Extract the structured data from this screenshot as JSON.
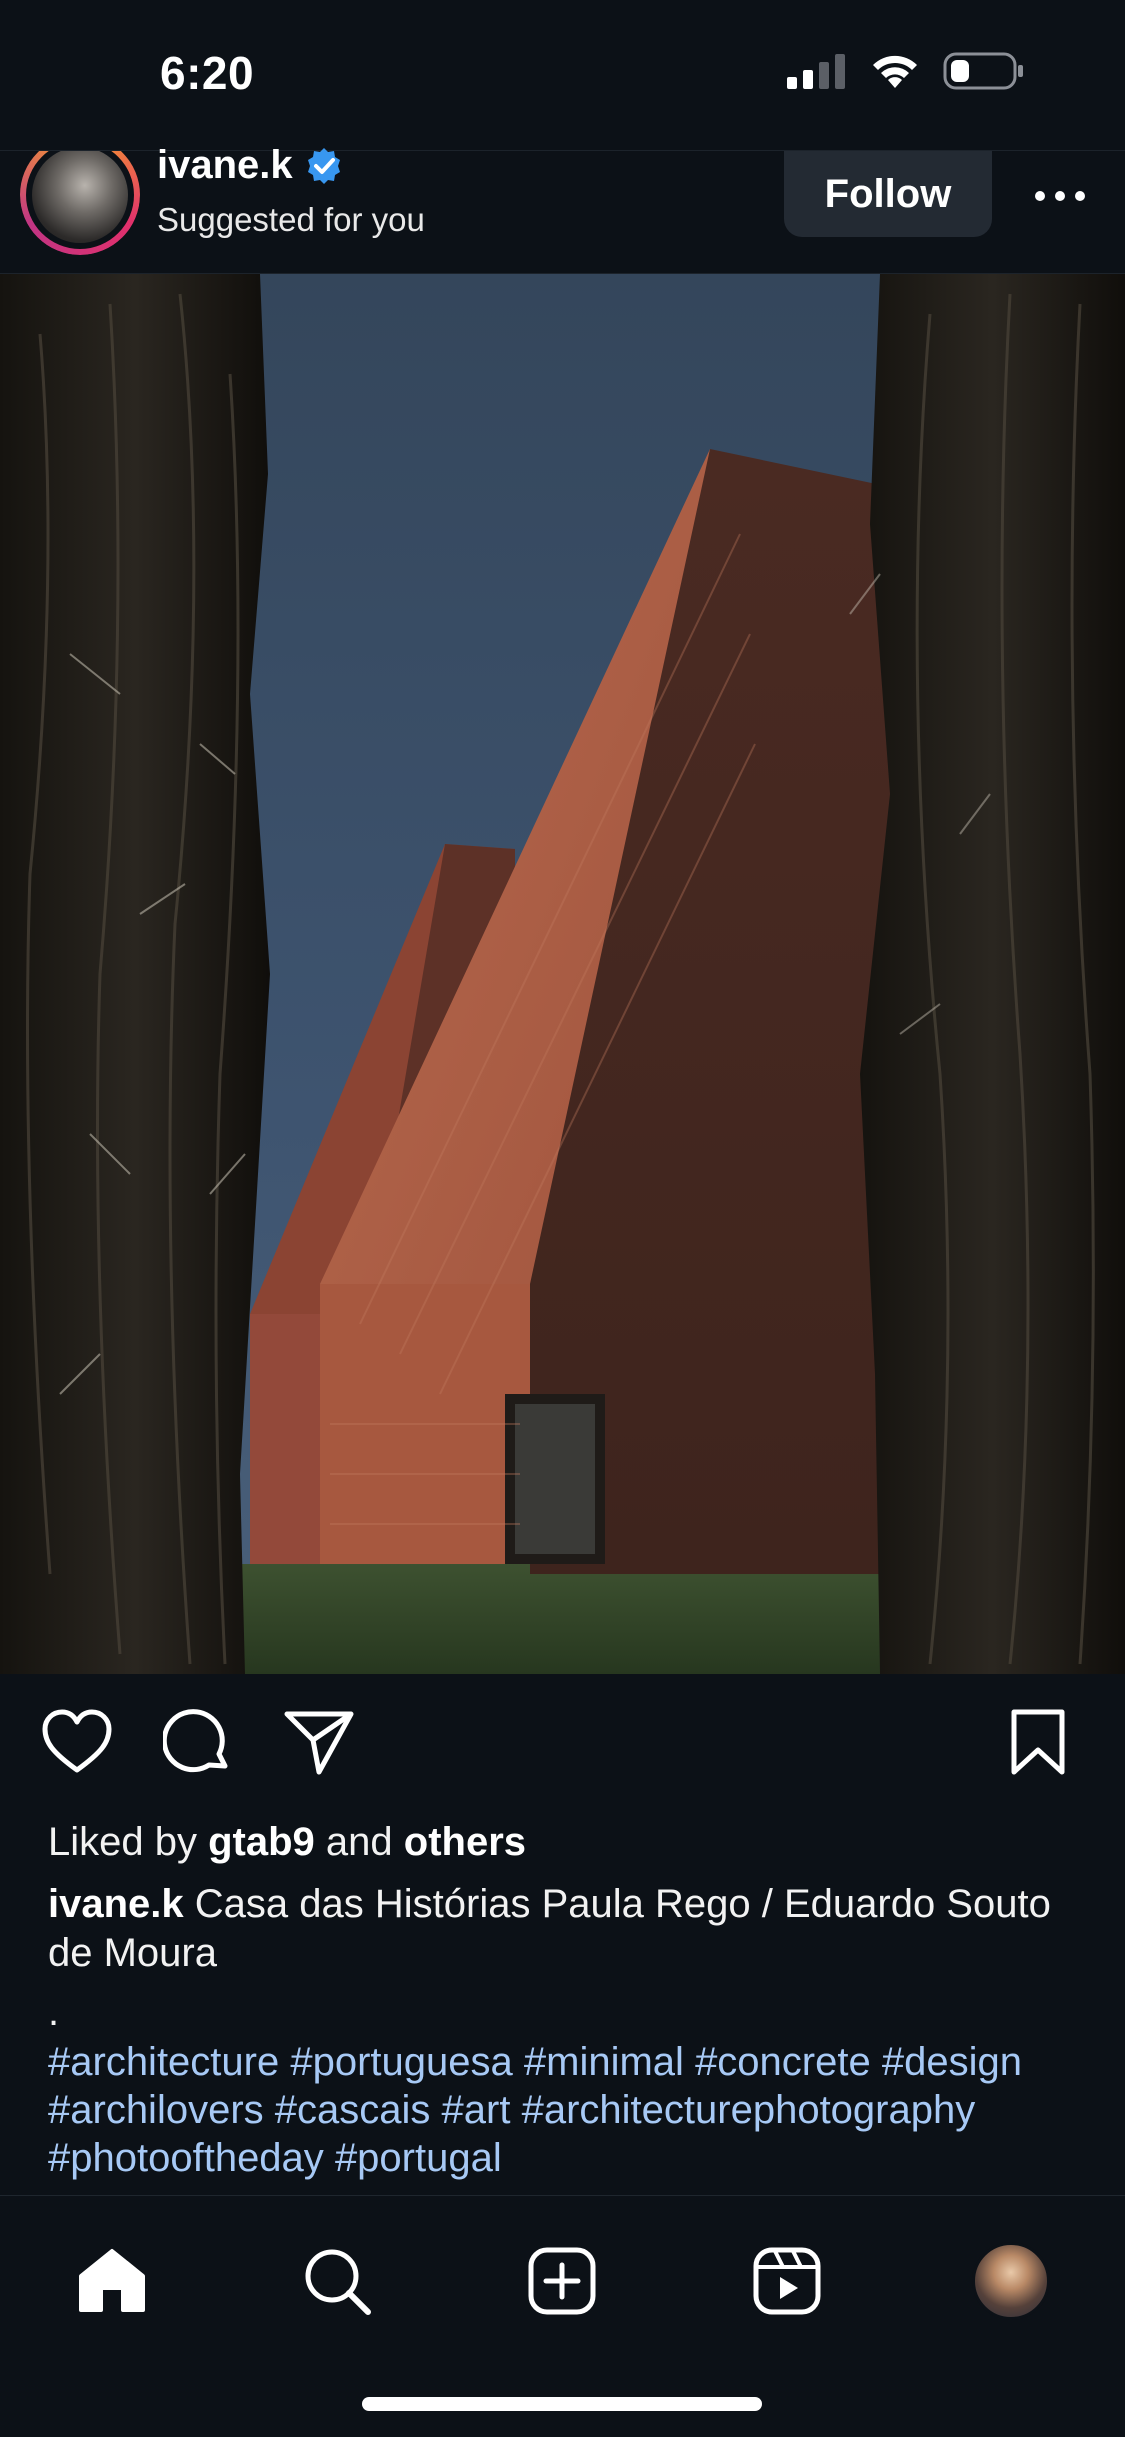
{
  "status_bar": {
    "time": "6:20",
    "signal_icon": "signal-icon",
    "wifi_icon": "wifi-icon",
    "battery_icon": "battery-icon"
  },
  "post": {
    "author": {
      "username": "ivane.k",
      "verified": true,
      "subtitle": "Suggested for you",
      "avatar_icon": "avatar"
    },
    "follow_label": "Follow",
    "more_icon": "more-options-icon",
    "image": {
      "subject": "post-photo"
    },
    "actions": {
      "like_icon": "heart-icon",
      "comment_icon": "comment-icon",
      "share_icon": "send-icon",
      "save_icon": "bookmark-icon"
    },
    "likes": {
      "prefix": "Liked by",
      "user": "gtab9",
      "middle": "and",
      "others": "others"
    },
    "caption": {
      "username": "ivane.k",
      "text": "Casa das Histórias Paula Rego / Eduardo Souto de Moura",
      "separator": "."
    },
    "hashtags": [
      "#architecture",
      "#portuguesa",
      "#minimal",
      "#concrete",
      "#design",
      "#archilovers",
      "#cascais",
      "#art",
      "#architecturephotography",
      "#photooftheday",
      "#portugal"
    ]
  },
  "tab_bar": {
    "items": [
      {
        "name": "home",
        "icon": "home-icon"
      },
      {
        "name": "search",
        "icon": "search-icon"
      },
      {
        "name": "create",
        "icon": "plus-square-icon"
      },
      {
        "name": "reels",
        "icon": "reels-icon"
      },
      {
        "name": "profile",
        "icon": "profile-avatar"
      }
    ]
  },
  "colors": {
    "background": "#0c1117",
    "hashtag": "#a7c9f5",
    "verified": "#3897f0",
    "follow_button": "#232a33"
  }
}
